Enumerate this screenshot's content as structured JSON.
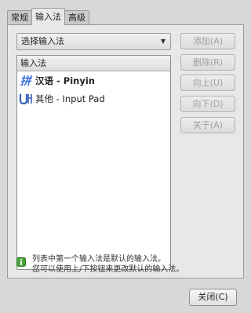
{
  "tabs": [
    {
      "label": "常规"
    },
    {
      "label": "输入法"
    },
    {
      "label": "高级"
    }
  ],
  "method_select": {
    "value": "选择输入法"
  },
  "list": {
    "header": "输入法",
    "items": [
      {
        "label": "汉语 - Pinyin",
        "icon": "pinyin-icon"
      },
      {
        "label": "其他 - Input Pad",
        "icon": "input-pad-icon"
      }
    ]
  },
  "buttons": {
    "add": "添加(A)",
    "remove": "删除(R)",
    "up": "向上(U)",
    "down": "向下(D)",
    "about": "关于(A)"
  },
  "info": {
    "line1": "列表中第一个输入法是默认的输入法。",
    "line2": "您可以使用上/下按钮来更改默认的输入法。",
    "icon": "info-icon"
  },
  "close_button": "关闭(C)",
  "colors": {
    "window_bg": "#d8d8d8",
    "page_bg": "#e8e8e8",
    "pinyin_icon": "#3a6fd8",
    "input_pad_icon": "#3b63b8",
    "info_icon": "#4aa33a"
  }
}
